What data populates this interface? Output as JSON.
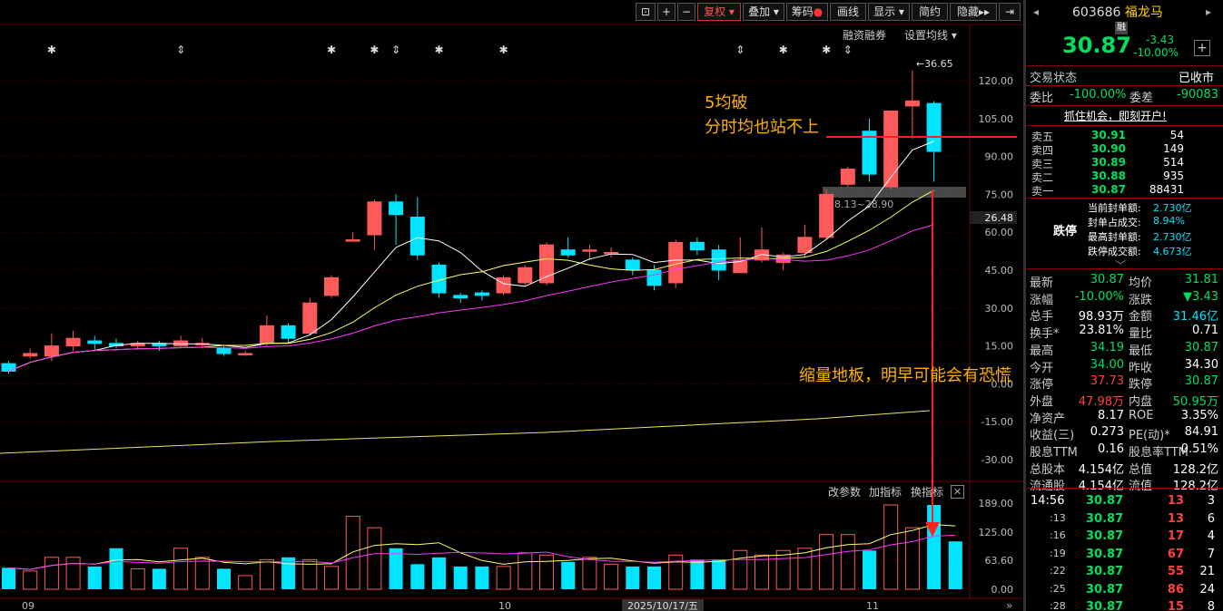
{
  "toolbar": {
    "buttons": [
      "复权",
      "叠加",
      "筹码",
      "画线",
      "显示",
      "简约",
      "隐藏"
    ],
    "links": [
      "融资融券",
      "设置均线"
    ]
  },
  "price_axis": [
    "120.00",
    "105.00",
    "90.00",
    "75.00",
    "60.00",
    "45.00",
    "30.00",
    "15.00",
    "0.00",
    "-15.00",
    "-30.00"
  ],
  "current_price_tag": "26.48",
  "high_marker": "36.65",
  "band_label": "28.13~28.90",
  "volume_axis": [
    "189.00",
    "125.00",
    "63.60",
    "0.00"
  ],
  "indicator_links": [
    "改参数",
    "加指标",
    "换指标"
  ],
  "date_labels": [
    "09",
    "10",
    "11"
  ],
  "cursor_date": "2025/10/17/五",
  "annotations": {
    "ma_break": "5均破",
    "avg_line": "分时均也站不上",
    "volume_note": "缩量地板，明早可能会有恐慌"
  },
  "stock": {
    "code": "603686",
    "name": "福龙马",
    "margin_tag": "融",
    "price": "30.87",
    "change": "-3.43",
    "change_pct": "-10.00%",
    "status_label": "交易状态",
    "status_value": "已收市",
    "weibi_label": "委比",
    "weibi_value": "-100.00%",
    "weicha_label": "委差",
    "weicha_value": "-90083",
    "promo": "抓住机会，即刻开户!"
  },
  "order_book": [
    {
      "label": "卖五",
      "price": "30.91",
      "vol": "54"
    },
    {
      "label": "卖四",
      "price": "30.90",
      "vol": "149"
    },
    {
      "label": "卖三",
      "price": "30.89",
      "vol": "514"
    },
    {
      "label": "卖二",
      "price": "30.88",
      "vol": "935"
    },
    {
      "label": "卖一",
      "price": "30.87",
      "vol": "88431"
    }
  ],
  "limit_down": {
    "title": "跌停",
    "rows": [
      {
        "label": "当前封单额:",
        "value": "2.730亿"
      },
      {
        "label": "封单占成交:",
        "value": "8.94%"
      },
      {
        "label": "最高封单额:",
        "value": "2.730亿"
      },
      {
        "label": "跌停成交额:",
        "value": "4.673亿"
      }
    ]
  },
  "stats": [
    {
      "l1": "最新",
      "v1": "30.87",
      "c1": "green",
      "l2": "均价",
      "v2": "31.81",
      "c2": "green"
    },
    {
      "l1": "涨幅",
      "v1": "-10.00%",
      "c1": "green",
      "l2": "涨跌",
      "v2": "▼3.43",
      "c2": "green"
    },
    {
      "l1": "总手",
      "v1": "98.93万",
      "c1": "white",
      "l2": "金额",
      "v2": "31.46亿",
      "c2": "cyan"
    },
    {
      "l1": "换手*",
      "v1": "23.81%",
      "c1": "white",
      "l2": "量比",
      "v2": "0.71",
      "c2": "white"
    },
    {
      "l1": "最高",
      "v1": "34.19",
      "c1": "green",
      "l2": "最低",
      "v2": "30.87",
      "c2": "green"
    },
    {
      "l1": "今开",
      "v1": "34.00",
      "c1": "green",
      "l2": "昨收",
      "v2": "34.30",
      "c2": "white"
    },
    {
      "l1": "涨停",
      "v1": "37.73",
      "c1": "red",
      "l2": "跌停",
      "v2": "30.87",
      "c2": "green"
    },
    {
      "l1": "外盘",
      "v1": "47.98万",
      "c1": "red",
      "l2": "内盘",
      "v2": "50.95万",
      "c2": "green"
    },
    {
      "l1": "净资产",
      "v1": "8.17",
      "c1": "white",
      "l2": "ROE",
      "v2": "3.35%",
      "c2": "white"
    },
    {
      "l1": "收益(三)",
      "v1": "0.273",
      "c1": "white",
      "l2": "PE(动)*",
      "v2": "84.91",
      "c2": "white"
    },
    {
      "l1": "股息TTM",
      "v1": "0.16",
      "c1": "white",
      "l2": "股息率TTM",
      "v2": "0.51%",
      "c2": "white"
    },
    {
      "l1": "总股本",
      "v1": "4.154亿",
      "c1": "white",
      "l2": "总值",
      "v2": "128.2亿",
      "c2": "white"
    },
    {
      "l1": "流通股",
      "v1": "4.154亿",
      "c1": "white",
      "l2": "流值",
      "v2": "128.2亿",
      "c2": "white"
    }
  ],
  "ticks": [
    {
      "time": "14:56",
      "price": "30.87",
      "vol": "13",
      "n": "3"
    },
    {
      "time": ":13",
      "price": "30.87",
      "vol": "13",
      "n": "6"
    },
    {
      "time": ":16",
      "price": "30.87",
      "vol": "17",
      "n": "4"
    },
    {
      "time": ":19",
      "price": "30.87",
      "vol": "67",
      "n": "7"
    },
    {
      "time": ":22",
      "price": "30.87",
      "vol": "55",
      "n": "21"
    },
    {
      "time": ":25",
      "price": "30.87",
      "vol": "86",
      "n": "24"
    },
    {
      "time": ":28",
      "price": "30.87",
      "vol": "15",
      "n": "8"
    }
  ],
  "chart_data": {
    "type": "candlestick",
    "price_scale": [
      -30,
      120
    ],
    "candles": [
      {
        "o": 8,
        "c": 5,
        "h": 9,
        "l": 4
      },
      {
        "o": 11,
        "c": 12,
        "h": 14,
        "l": 10
      },
      {
        "o": 11,
        "c": 15,
        "h": 20,
        "l": 9
      },
      {
        "o": 15,
        "c": 18,
        "h": 21,
        "l": 13
      },
      {
        "o": 17,
        "c": 16,
        "h": 19,
        "l": 13
      },
      {
        "o": 16,
        "c": 15,
        "h": 18,
        "l": 14
      },
      {
        "o": 15,
        "c": 16,
        "h": 17,
        "l": 14
      },
      {
        "o": 16,
        "c": 15,
        "h": 17,
        "l": 13
      },
      {
        "o": 15,
        "c": 17,
        "h": 19,
        "l": 14
      },
      {
        "o": 16,
        "c": 16,
        "h": 18,
        "l": 14
      },
      {
        "o": 14,
        "c": 12,
        "h": 15,
        "l": 11
      },
      {
        "o": 12,
        "c": 12,
        "h": 13,
        "l": 11
      },
      {
        "o": 16,
        "c": 23,
        "h": 27,
        "l": 15
      },
      {
        "o": 23,
        "c": 18,
        "h": 24,
        "l": 16
      },
      {
        "o": 20,
        "c": 32,
        "h": 34,
        "l": 19
      },
      {
        "o": 35,
        "c": 42,
        "h": 43,
        "l": 34
      },
      {
        "o": 57,
        "c": 57,
        "h": 60,
        "l": 57
      },
      {
        "o": 59,
        "c": 72,
        "h": 73,
        "l": 53
      },
      {
        "o": 72,
        "c": 67,
        "h": 75,
        "l": 55
      },
      {
        "o": 66,
        "c": 51,
        "h": 74,
        "l": 49
      },
      {
        "o": 47,
        "c": 36,
        "h": 48,
        "l": 34
      },
      {
        "o": 35,
        "c": 34,
        "h": 36,
        "l": 32
      },
      {
        "o": 36,
        "c": 35,
        "h": 37,
        "l": 33
      },
      {
        "o": 36,
        "c": 42,
        "h": 43,
        "l": 35
      },
      {
        "o": 40,
        "c": 46,
        "h": 47,
        "l": 39
      },
      {
        "o": 40,
        "c": 55,
        "h": 56,
        "l": 39
      },
      {
        "o": 53,
        "c": 51,
        "h": 58,
        "l": 50
      },
      {
        "o": 53,
        "c": 53,
        "h": 55,
        "l": 49
      },
      {
        "o": 52,
        "c": 52,
        "h": 54,
        "l": 50
      },
      {
        "o": 49,
        "c": 45,
        "h": 50,
        "l": 43
      },
      {
        "o": 45,
        "c": 39,
        "h": 47,
        "l": 37
      },
      {
        "o": 40,
        "c": 56,
        "h": 57,
        "l": 38
      },
      {
        "o": 56,
        "c": 53,
        "h": 58,
        "l": 51
      },
      {
        "o": 53,
        "c": 45,
        "h": 55,
        "l": 41
      },
      {
        "o": 44,
        "c": 49,
        "h": 58,
        "l": 44
      },
      {
        "o": 49,
        "c": 53,
        "h": 62,
        "l": 48
      },
      {
        "o": 48,
        "c": 51,
        "h": 52,
        "l": 45
      },
      {
        "o": 52,
        "c": 58,
        "h": 63,
        "l": 50
      },
      {
        "o": 58,
        "c": 75,
        "h": 77,
        "l": 57
      },
      {
        "o": 79,
        "c": 85,
        "h": 86,
        "l": 78
      },
      {
        "o": 100,
        "c": 83,
        "h": 105,
        "l": 80
      },
      {
        "o": 78,
        "c": 108,
        "h": 108,
        "l": 77
      },
      {
        "o": 110,
        "c": 112,
        "h": 124,
        "l": 97
      },
      {
        "o": 111,
        "c": 92,
        "h": 112,
        "l": 80
      }
    ],
    "volume": [
      47,
      40,
      70,
      70,
      50,
      90,
      45,
      45,
      90,
      70,
      45,
      30,
      65,
      70,
      65,
      50,
      160,
      135,
      90,
      55,
      70,
      50,
      50,
      50,
      80,
      75,
      60,
      70,
      55,
      50,
      50,
      75,
      65,
      65,
      85,
      75,
      85,
      90,
      120,
      120,
      85,
      185,
      135,
      185,
      105
    ],
    "volume_scale": [
      0,
      189
    ]
  }
}
